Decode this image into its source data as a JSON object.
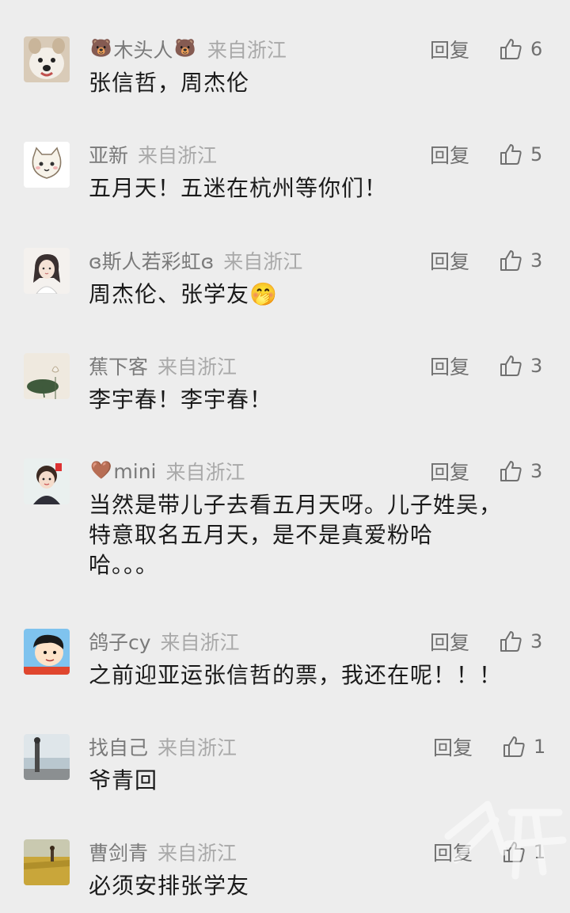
{
  "reply_label": "回复",
  "comments": [
    {
      "prefix_emoji": "🐻",
      "name": "木头人",
      "suffix_emoji": "🐻",
      "location": "来自浙江",
      "likes": "6",
      "text": [
        "张信哲，周杰伦"
      ]
    },
    {
      "name": "亚新",
      "location": "来自浙江",
      "likes": "5",
      "text": [
        "五月天！五迷在杭州等你们！"
      ]
    },
    {
      "name": "ɞ斯人若彩虹ɞ",
      "location": "来自浙江",
      "likes": "3",
      "text": [
        "周杰伦、张学友🤭"
      ]
    },
    {
      "name": "蕉下客",
      "location": "来自浙江",
      "likes": "3",
      "text": [
        "李宇春！李宇春！"
      ]
    },
    {
      "prefix_emoji": "🤎",
      "name": "mini",
      "location": "来自浙江",
      "likes": "3",
      "text": [
        "当然是带儿子去看五月天呀。儿子姓吴，",
        "特意取名五月天，是不是真爱粉哈",
        "哈。。。"
      ]
    },
    {
      "name": "鸽子cy",
      "location": "来自浙江",
      "likes": "3",
      "text": [
        "之前迎亚运张信哲的票，我还在呢！！！"
      ]
    },
    {
      "name": "找自己",
      "location": "来自浙江",
      "likes": "1",
      "text": [
        "爷青回"
      ]
    },
    {
      "name": "曹剑青",
      "location": "来自浙江",
      "likes": "1",
      "text": [
        "必须安排张学友"
      ]
    }
  ],
  "colors": {
    "background": "#ededed",
    "name": "#7a7a7a",
    "location": "#a9a9a9",
    "text": "#1a1a1a"
  },
  "icons": {
    "like": "thumbs-up-icon",
    "watermark": "橙柿 logo watermark"
  }
}
